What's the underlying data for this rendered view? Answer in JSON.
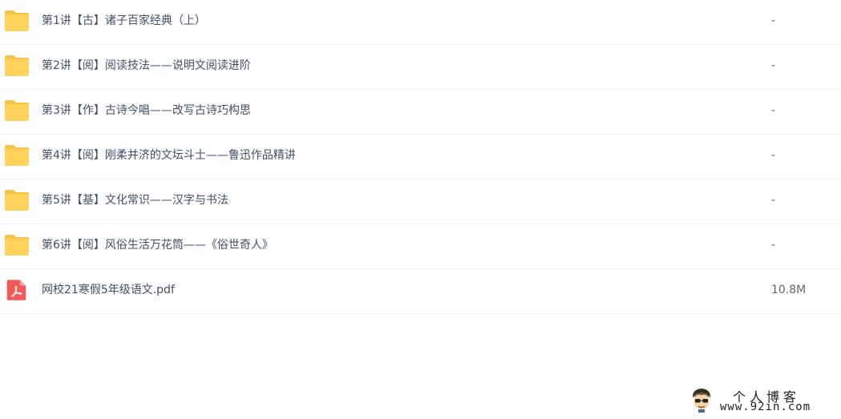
{
  "files": [
    {
      "icon": "folder-icon",
      "name": "第1讲【古】诸子百家经典（上）",
      "size": "-"
    },
    {
      "icon": "folder-icon",
      "name": "第2讲【阅】阅读技法——说明文阅读进阶",
      "size": "-"
    },
    {
      "icon": "folder-icon",
      "name": "第3讲【作】古诗今唱——改写古诗巧构思",
      "size": "-"
    },
    {
      "icon": "folder-icon",
      "name": "第4讲【阅】刚柔并济的文坛斗士——鲁迅作品精讲",
      "size": "-"
    },
    {
      "icon": "folder-icon",
      "name": "第5讲【基】文化常识——汉字与书法",
      "size": "-"
    },
    {
      "icon": "folder-icon",
      "name": "第6讲【阅】风俗生活万花筒——《俗世奇人》",
      "size": "-"
    },
    {
      "icon": "pdf-icon",
      "name": "网校21寒假5年级语文.pdf",
      "size": "10.8M"
    }
  ],
  "watermark": {
    "title": "个人博客",
    "url": "www.92in.com"
  },
  "colors": {
    "folder": "#ffd35c",
    "folder_tab": "#f7c342",
    "pdf": "#f25a5a"
  }
}
